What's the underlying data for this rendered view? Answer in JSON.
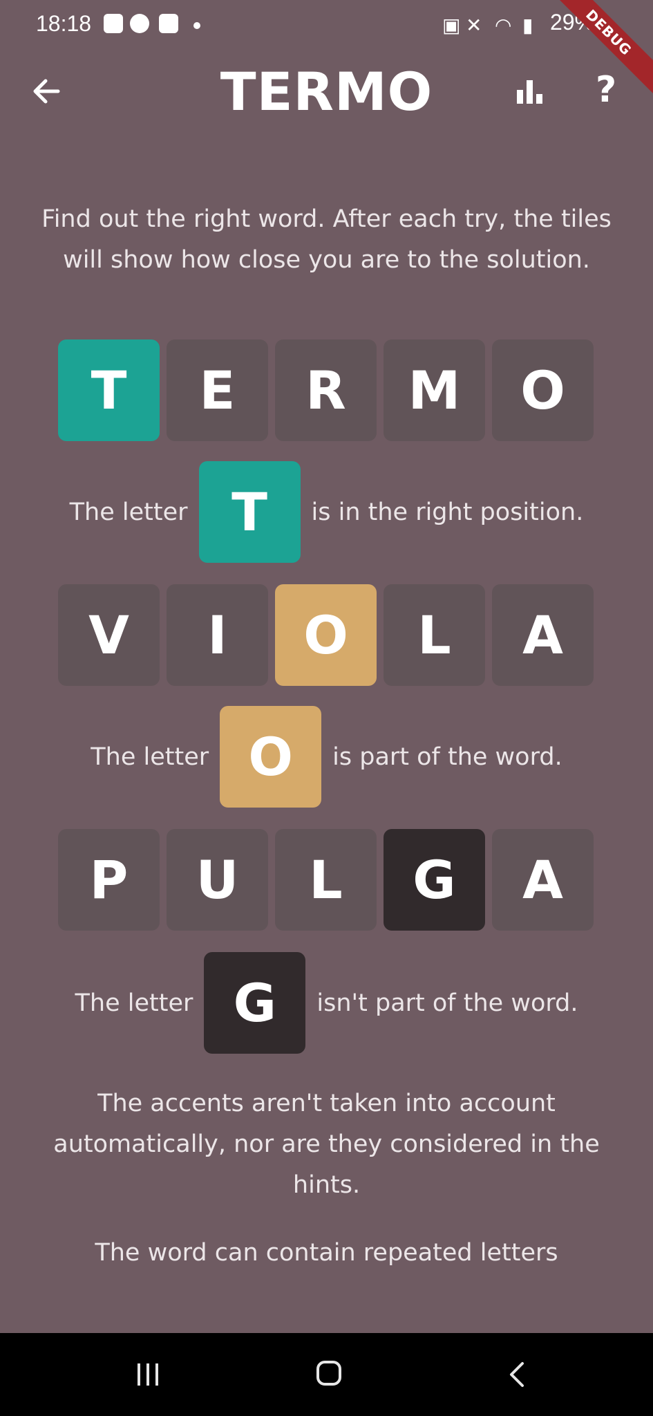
{
  "status_bar": {
    "time": "18:18",
    "battery": "29%",
    "debug_label": "DEBUG"
  },
  "appbar": {
    "title": "TERMO",
    "help_label": "?"
  },
  "intro": "Find out the right word. After each try, the tiles will show how close you are to the solution.",
  "examples": [
    {
      "word": [
        "T",
        "E",
        "R",
        "M",
        "O"
      ],
      "highlight_index": 0,
      "state": "right",
      "hint_prefix": "The letter",
      "hint_letter": "T",
      "hint_suffix": "is in the right position."
    },
    {
      "word": [
        "V",
        "I",
        "O",
        "L",
        "A"
      ],
      "highlight_index": 2,
      "state": "place",
      "hint_prefix": "The letter",
      "hint_letter": "O",
      "hint_suffix": "is part of the word."
    },
    {
      "word": [
        "P",
        "U",
        "L",
        "G",
        "A"
      ],
      "highlight_index": 3,
      "state": "wrong",
      "hint_prefix": "The letter",
      "hint_letter": "G",
      "hint_suffix": "isn't part of the word."
    }
  ],
  "accents_note": "The accents aren't taken into account automatically, nor are they considered in the hints.",
  "repeat_note": "The word can contain repeated letters",
  "colors": {
    "background": "#6f5b62",
    "tile_default": "#615458",
    "tile_right": "#1ca394",
    "tile_place": "#d6aa6a",
    "tile_wrong": "#312a2c"
  }
}
